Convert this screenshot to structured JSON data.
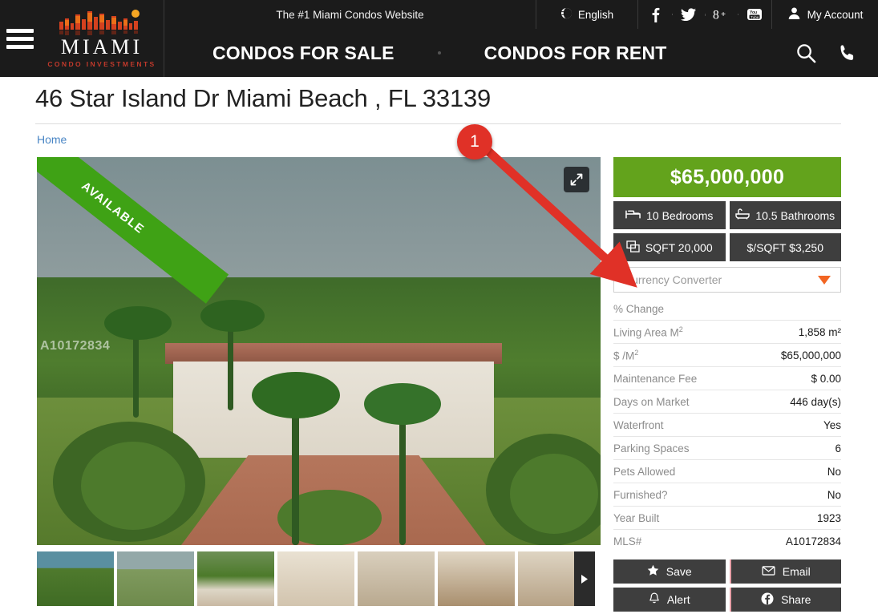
{
  "topbar": {
    "tagline": "The #1 Miami Condos Website",
    "language": "English",
    "language_icon": "globe-icon",
    "account": "My Account",
    "account_icon": "user-icon",
    "socials": [
      {
        "name": "facebook-icon",
        "glyph": "f"
      },
      {
        "name": "twitter-icon",
        "glyph": "t"
      },
      {
        "name": "google-plus-icon",
        "glyph": "g+"
      },
      {
        "name": "youtube-icon",
        "glyph": "yt"
      }
    ]
  },
  "brand": {
    "name": "MIAMI",
    "sub": "CONDO INVESTMENTS",
    "menu_icon": "hamburger-menu-icon"
  },
  "nav": {
    "sale": "CONDOS FOR SALE",
    "rent": "CONDOS FOR RENT",
    "search_icon": "search-icon",
    "phone_icon": "phone-icon"
  },
  "page": {
    "title": "46 Star Island Dr Miami Beach , FL 33139",
    "breadcrumb": "Home"
  },
  "gallery": {
    "ribbon": "AVAILABLE",
    "watermark": "A10172834",
    "expand_icon": "expand-icon",
    "next_icon": "next-arrow-icon",
    "thumb_count": 7
  },
  "listing": {
    "price": "$65,000,000",
    "specs": [
      {
        "icon": "bed-icon",
        "label": "10 Bedrooms"
      },
      {
        "icon": "bathtub-icon",
        "label": "10.5 Bathrooms"
      },
      {
        "icon": "area-icon",
        "label": "SQFT 20,000"
      },
      {
        "icon": "",
        "label": "$/SQFT $3,250"
      }
    ],
    "currency_converter": {
      "placeholder": "Currency Converter",
      "caret_icon": "chevron-down-icon",
      "caret_color": "#f26522"
    },
    "facts": [
      {
        "key": "% Change",
        "value": ""
      },
      {
        "key": "Living Area M",
        "sup": "2",
        "value": "1,858 m²"
      },
      {
        "key": "$ /M",
        "sup": "2",
        "value": "$65,000,000"
      },
      {
        "key": "Maintenance Fee",
        "value": "$ 0.00"
      },
      {
        "key": "Days on Market",
        "value": "446 day(s)"
      },
      {
        "key": "Waterfront",
        "value": "Yes"
      },
      {
        "key": "Parking Spaces",
        "value": "6"
      },
      {
        "key": "Pets Allowed",
        "value": "No"
      },
      {
        "key": "Furnished?",
        "value": "No"
      },
      {
        "key": "Year Built",
        "value": "1923"
      },
      {
        "key": "MLS#",
        "value": "A10172834"
      }
    ],
    "actions": [
      {
        "icon": "star-icon",
        "label": "Save"
      },
      {
        "icon": "envelope-icon",
        "label": "Email"
      },
      {
        "icon": "bell-icon",
        "label": "Alert"
      },
      {
        "icon": "facebook-icon",
        "label": "Share"
      }
    ]
  },
  "annotation": {
    "badge": "1",
    "color": "#e03127"
  },
  "colors": {
    "price_green": "#63a31c",
    "spec_gray": "#3e3e3e",
    "nav_black": "#1b1b1b",
    "accent_orange": "#f26522",
    "link_blue": "#4a86c5"
  }
}
